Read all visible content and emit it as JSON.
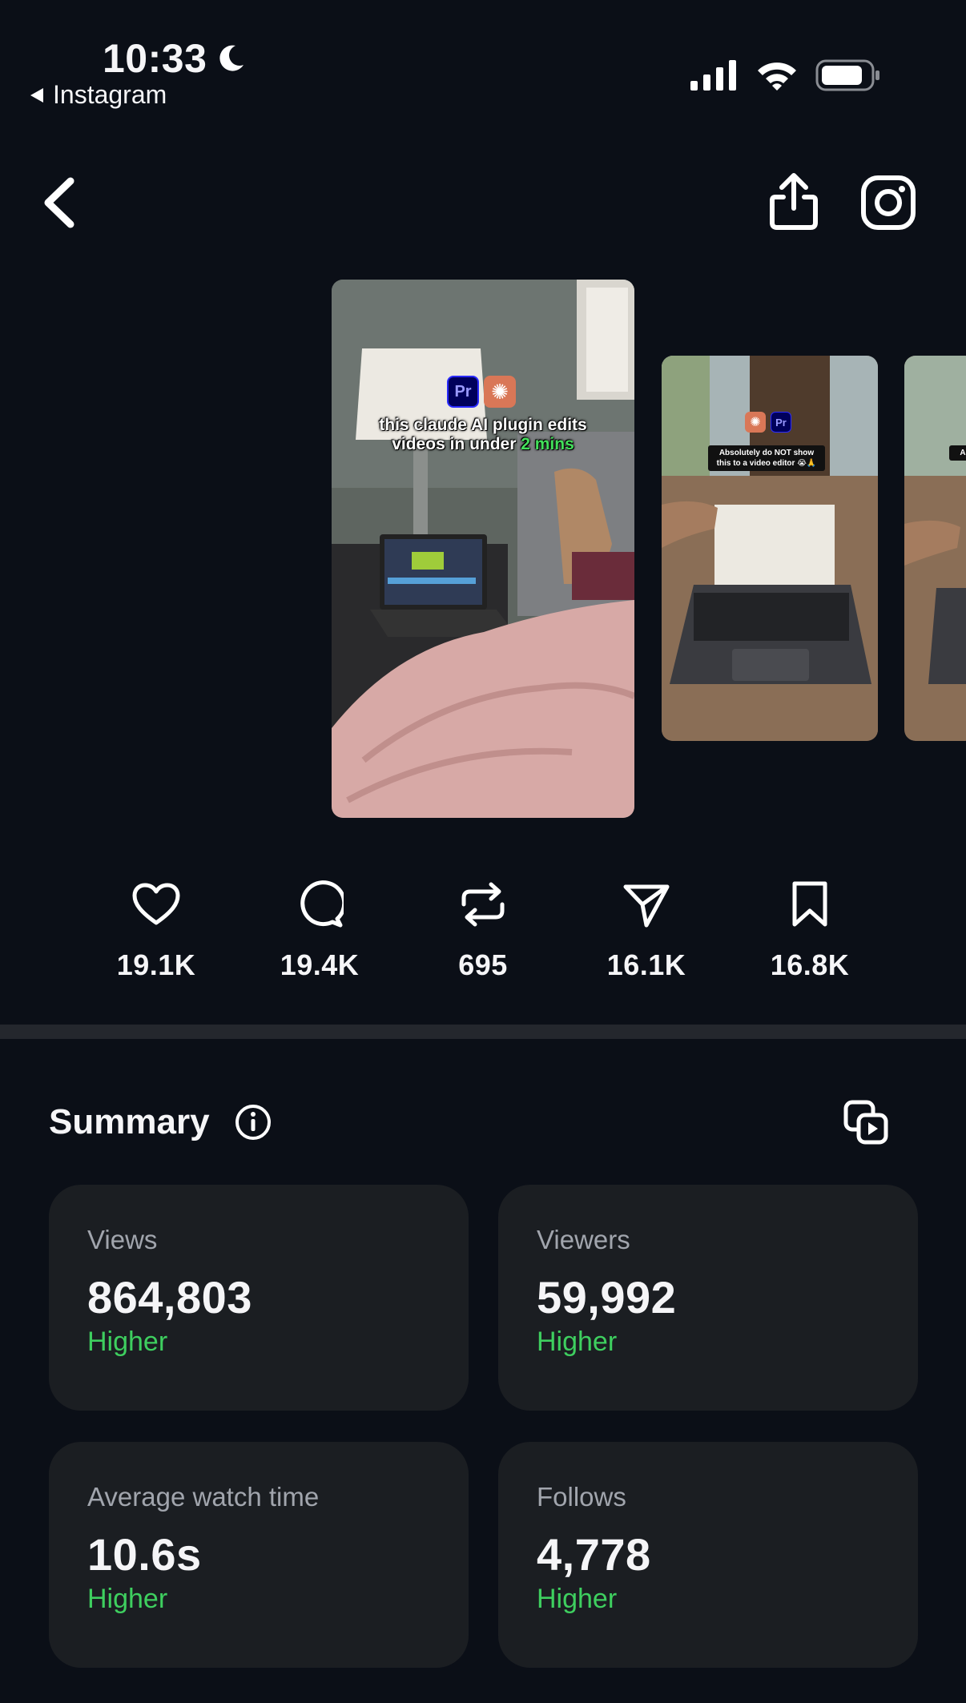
{
  "status_bar": {
    "time": "10:33",
    "back_app": "Instagram"
  },
  "media": {
    "main_caption_line1": "this claude AI plugin edits",
    "main_caption_line2_prefix": "videos in under ",
    "main_caption_line2_highlight": "2 mins",
    "second_caption": "Absolutely do NOT show this to a video editor 😭🙏",
    "third_caption": "Ab",
    "badge_pr": "Pr"
  },
  "metrics": [
    {
      "icon": "heart-icon",
      "value": "19.1K"
    },
    {
      "icon": "comment-icon",
      "value": "19.4K"
    },
    {
      "icon": "repost-icon",
      "value": "695"
    },
    {
      "icon": "send-icon",
      "value": "16.1K"
    },
    {
      "icon": "bookmark-icon",
      "value": "16.8K"
    }
  ],
  "summary": {
    "title": "Summary",
    "cards": [
      {
        "label": "Views",
        "value": "864,803",
        "trend": "Higher"
      },
      {
        "label": "Viewers",
        "value": "59,992",
        "trend": "Higher"
      },
      {
        "label": "Average watch time",
        "value": "10.6s",
        "trend": "Higher"
      },
      {
        "label": "Follows",
        "value": "4,778",
        "trend": "Higher"
      }
    ]
  },
  "colors": {
    "background": "#0b0f17",
    "card": "#1b1e22",
    "positive": "#3ecf5f",
    "muted_text": "#a1a5ad"
  }
}
